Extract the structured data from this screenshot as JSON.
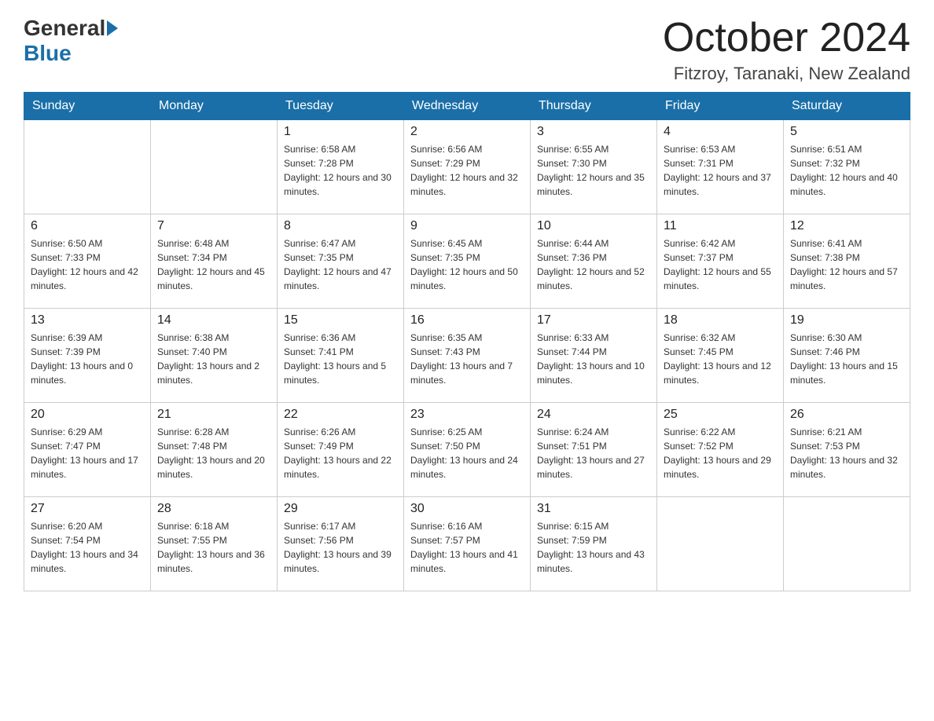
{
  "logo": {
    "general": "General",
    "blue": "Blue"
  },
  "title": "October 2024",
  "location": "Fitzroy, Taranaki, New Zealand",
  "weekdays": [
    "Sunday",
    "Monday",
    "Tuesday",
    "Wednesday",
    "Thursday",
    "Friday",
    "Saturday"
  ],
  "weeks": [
    [
      {
        "day": "",
        "sunrise": "",
        "sunset": "",
        "daylight": ""
      },
      {
        "day": "",
        "sunrise": "",
        "sunset": "",
        "daylight": ""
      },
      {
        "day": "1",
        "sunrise": "Sunrise: 6:58 AM",
        "sunset": "Sunset: 7:28 PM",
        "daylight": "Daylight: 12 hours and 30 minutes."
      },
      {
        "day": "2",
        "sunrise": "Sunrise: 6:56 AM",
        "sunset": "Sunset: 7:29 PM",
        "daylight": "Daylight: 12 hours and 32 minutes."
      },
      {
        "day": "3",
        "sunrise": "Sunrise: 6:55 AM",
        "sunset": "Sunset: 7:30 PM",
        "daylight": "Daylight: 12 hours and 35 minutes."
      },
      {
        "day": "4",
        "sunrise": "Sunrise: 6:53 AM",
        "sunset": "Sunset: 7:31 PM",
        "daylight": "Daylight: 12 hours and 37 minutes."
      },
      {
        "day": "5",
        "sunrise": "Sunrise: 6:51 AM",
        "sunset": "Sunset: 7:32 PM",
        "daylight": "Daylight: 12 hours and 40 minutes."
      }
    ],
    [
      {
        "day": "6",
        "sunrise": "Sunrise: 6:50 AM",
        "sunset": "Sunset: 7:33 PM",
        "daylight": "Daylight: 12 hours and 42 minutes."
      },
      {
        "day": "7",
        "sunrise": "Sunrise: 6:48 AM",
        "sunset": "Sunset: 7:34 PM",
        "daylight": "Daylight: 12 hours and 45 minutes."
      },
      {
        "day": "8",
        "sunrise": "Sunrise: 6:47 AM",
        "sunset": "Sunset: 7:35 PM",
        "daylight": "Daylight: 12 hours and 47 minutes."
      },
      {
        "day": "9",
        "sunrise": "Sunrise: 6:45 AM",
        "sunset": "Sunset: 7:35 PM",
        "daylight": "Daylight: 12 hours and 50 minutes."
      },
      {
        "day": "10",
        "sunrise": "Sunrise: 6:44 AM",
        "sunset": "Sunset: 7:36 PM",
        "daylight": "Daylight: 12 hours and 52 minutes."
      },
      {
        "day": "11",
        "sunrise": "Sunrise: 6:42 AM",
        "sunset": "Sunset: 7:37 PM",
        "daylight": "Daylight: 12 hours and 55 minutes."
      },
      {
        "day": "12",
        "sunrise": "Sunrise: 6:41 AM",
        "sunset": "Sunset: 7:38 PM",
        "daylight": "Daylight: 12 hours and 57 minutes."
      }
    ],
    [
      {
        "day": "13",
        "sunrise": "Sunrise: 6:39 AM",
        "sunset": "Sunset: 7:39 PM",
        "daylight": "Daylight: 13 hours and 0 minutes."
      },
      {
        "day": "14",
        "sunrise": "Sunrise: 6:38 AM",
        "sunset": "Sunset: 7:40 PM",
        "daylight": "Daylight: 13 hours and 2 minutes."
      },
      {
        "day": "15",
        "sunrise": "Sunrise: 6:36 AM",
        "sunset": "Sunset: 7:41 PM",
        "daylight": "Daylight: 13 hours and 5 minutes."
      },
      {
        "day": "16",
        "sunrise": "Sunrise: 6:35 AM",
        "sunset": "Sunset: 7:43 PM",
        "daylight": "Daylight: 13 hours and 7 minutes."
      },
      {
        "day": "17",
        "sunrise": "Sunrise: 6:33 AM",
        "sunset": "Sunset: 7:44 PM",
        "daylight": "Daylight: 13 hours and 10 minutes."
      },
      {
        "day": "18",
        "sunrise": "Sunrise: 6:32 AM",
        "sunset": "Sunset: 7:45 PM",
        "daylight": "Daylight: 13 hours and 12 minutes."
      },
      {
        "day": "19",
        "sunrise": "Sunrise: 6:30 AM",
        "sunset": "Sunset: 7:46 PM",
        "daylight": "Daylight: 13 hours and 15 minutes."
      }
    ],
    [
      {
        "day": "20",
        "sunrise": "Sunrise: 6:29 AM",
        "sunset": "Sunset: 7:47 PM",
        "daylight": "Daylight: 13 hours and 17 minutes."
      },
      {
        "day": "21",
        "sunrise": "Sunrise: 6:28 AM",
        "sunset": "Sunset: 7:48 PM",
        "daylight": "Daylight: 13 hours and 20 minutes."
      },
      {
        "day": "22",
        "sunrise": "Sunrise: 6:26 AM",
        "sunset": "Sunset: 7:49 PM",
        "daylight": "Daylight: 13 hours and 22 minutes."
      },
      {
        "day": "23",
        "sunrise": "Sunrise: 6:25 AM",
        "sunset": "Sunset: 7:50 PM",
        "daylight": "Daylight: 13 hours and 24 minutes."
      },
      {
        "day": "24",
        "sunrise": "Sunrise: 6:24 AM",
        "sunset": "Sunset: 7:51 PM",
        "daylight": "Daylight: 13 hours and 27 minutes."
      },
      {
        "day": "25",
        "sunrise": "Sunrise: 6:22 AM",
        "sunset": "Sunset: 7:52 PM",
        "daylight": "Daylight: 13 hours and 29 minutes."
      },
      {
        "day": "26",
        "sunrise": "Sunrise: 6:21 AM",
        "sunset": "Sunset: 7:53 PM",
        "daylight": "Daylight: 13 hours and 32 minutes."
      }
    ],
    [
      {
        "day": "27",
        "sunrise": "Sunrise: 6:20 AM",
        "sunset": "Sunset: 7:54 PM",
        "daylight": "Daylight: 13 hours and 34 minutes."
      },
      {
        "day": "28",
        "sunrise": "Sunrise: 6:18 AM",
        "sunset": "Sunset: 7:55 PM",
        "daylight": "Daylight: 13 hours and 36 minutes."
      },
      {
        "day": "29",
        "sunrise": "Sunrise: 6:17 AM",
        "sunset": "Sunset: 7:56 PM",
        "daylight": "Daylight: 13 hours and 39 minutes."
      },
      {
        "day": "30",
        "sunrise": "Sunrise: 6:16 AM",
        "sunset": "Sunset: 7:57 PM",
        "daylight": "Daylight: 13 hours and 41 minutes."
      },
      {
        "day": "31",
        "sunrise": "Sunrise: 6:15 AM",
        "sunset": "Sunset: 7:59 PM",
        "daylight": "Daylight: 13 hours and 43 minutes."
      },
      {
        "day": "",
        "sunrise": "",
        "sunset": "",
        "daylight": ""
      },
      {
        "day": "",
        "sunrise": "",
        "sunset": "",
        "daylight": ""
      }
    ]
  ]
}
